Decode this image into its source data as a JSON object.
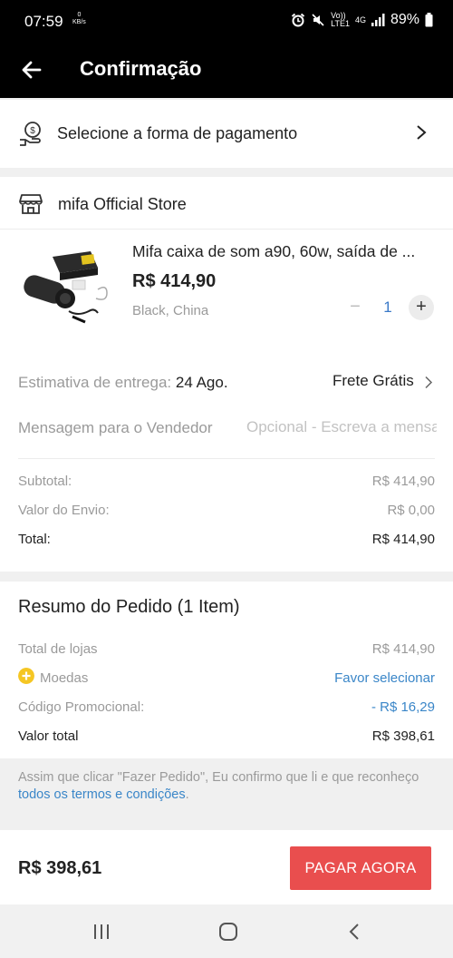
{
  "status": {
    "time": "07:59",
    "speed_value": "0",
    "speed_unit": "KB/s",
    "volte": "Vo))",
    "lte": "LTE1",
    "network": "4G",
    "battery": "89%"
  },
  "header": {
    "title": "Confirmação"
  },
  "payment": {
    "label": "Selecione a forma de pagamento",
    "icon": "payment-hand-icon"
  },
  "store": {
    "name": "mifa Official Store",
    "product": {
      "title": "Mifa caixa de som a90, 60w, saída de ...",
      "price": "R$ 414,90",
      "variant": "Black, China",
      "quantity": "1",
      "minus": "−",
      "plus": "+"
    },
    "delivery": {
      "label": "Estimativa de entrega:",
      "date": "24 Ago.",
      "shipping": "Frete Grátis"
    },
    "message": {
      "label": "Mensagem para o Vendedor",
      "placeholder": "Opcional - Escreva a mensagem"
    },
    "subtotal": {
      "label": "Subtotal:",
      "value": "R$ 414,90"
    },
    "shipping_value": {
      "label": "Valor do Envio:",
      "value": "R$ 0,00"
    },
    "total": {
      "label": "Total:",
      "value": "R$ 414,90"
    }
  },
  "summary": {
    "title": "Resumo do Pedido (1 Item)",
    "stores_total": {
      "label": "Total de lojas",
      "value": "R$ 414,90"
    },
    "coins": {
      "label": "Moedas",
      "value": "Favor selecionar"
    },
    "promo": {
      "label": "Código Promocional:",
      "value": "- R$ 16,29"
    },
    "grand_total": {
      "label": "Valor total",
      "value": "R$ 398,61"
    }
  },
  "terms": {
    "text": "Assim que clicar \"Fazer Pedido\", Eu confirmo que li e que reconheço ",
    "link": "todos os termos e condições",
    "end": "."
  },
  "footer": {
    "total": "R$ 398,61",
    "pay_label": "PAGAR AGORA"
  },
  "colors": {
    "accent_red": "#e94e4e",
    "link_blue": "#3a86c8"
  }
}
